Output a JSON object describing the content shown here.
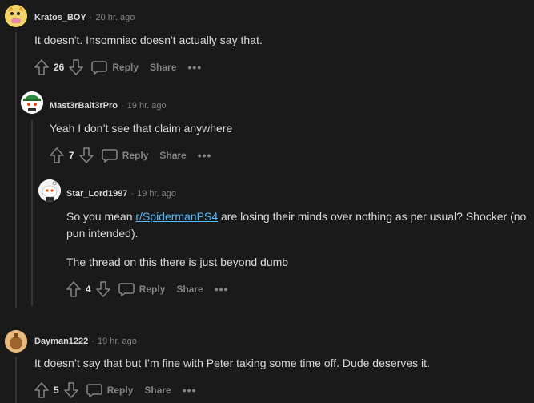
{
  "comments": [
    {
      "user": "Kratos_BOY",
      "time": "20 hr. ago",
      "body": "It doesn't. Insomniac doesn't actually say that.",
      "votes": "26",
      "reply": "Reply",
      "share": "Share",
      "more": "•••"
    },
    {
      "user": "Mast3rBait3rPro",
      "time": "19 hr. ago",
      "body": "Yeah I don’t see that claim anywhere",
      "votes": "7",
      "reply": "Reply",
      "share": "Share",
      "more": "•••"
    },
    {
      "user": "Star_Lord1997",
      "time": "19 hr. ago",
      "body_p1_before": "So you mean ",
      "body_p1_link": "r/SpidermanPS4",
      "body_p1_after": " are losing their minds over nothing as per usual? Shocker (no pun intended).",
      "body_p2": "The thread on this there is just beyond dumb",
      "votes": "4",
      "reply": "Reply",
      "share": "Share",
      "more": "•••"
    },
    {
      "user": "Dayman1222",
      "time": "19 hr. ago",
      "body": "It doesn’t say that but I’m fine with Peter taking some time off. Dude deserves it.",
      "votes": "5",
      "reply": "Reply",
      "share": "Share",
      "more": "•••"
    }
  ],
  "separator": "·",
  "colors": {
    "background": "#1a1a1b",
    "text": "#d7dadc",
    "muted": "#818384",
    "link": "#4fbcff",
    "thread_line": "#343536"
  }
}
